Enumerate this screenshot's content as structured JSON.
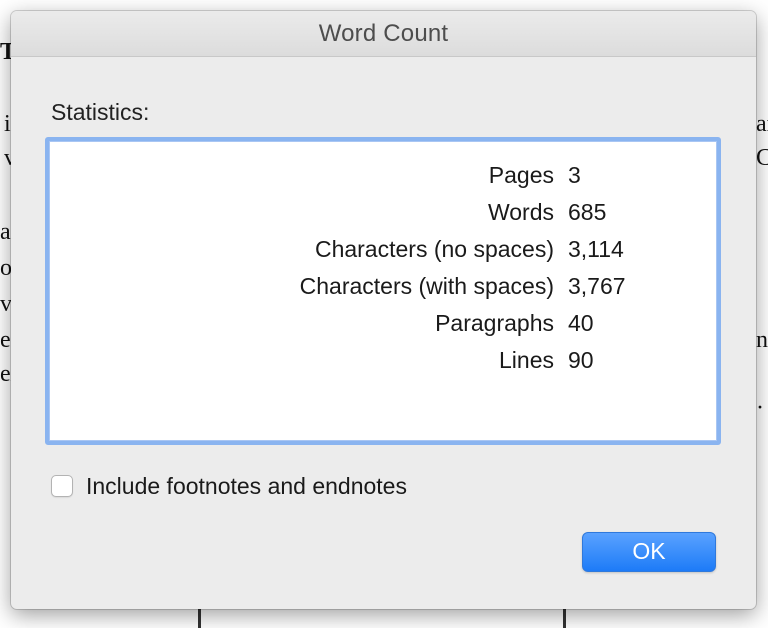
{
  "dialog": {
    "title": "Word Count",
    "statistics_label": "Statistics:",
    "stats": [
      {
        "label": "Pages",
        "value": "3"
      },
      {
        "label": "Words",
        "value": "685"
      },
      {
        "label": "Characters (no spaces)",
        "value": "3,114"
      },
      {
        "label": "Characters (with spaces)",
        "value": "3,767"
      },
      {
        "label": "Paragraphs",
        "value": "40"
      },
      {
        "label": "Lines",
        "value": "90"
      }
    ],
    "include_footnotes_label": "Include footnotes and endnotes",
    "include_footnotes_checked": false,
    "ok_label": "OK",
    "colors": {
      "accent": "#1d7bf7",
      "focus_ring": "#8ab4f0",
      "sheet_bg": "#ececec"
    }
  },
  "background_document": {
    "left_fragments": [
      "T",
      "i",
      "v",
      "ar",
      "o",
      "vi",
      "e",
      "ex"
    ],
    "right_fragments": [
      "ar",
      "C",
      "n",
      "·"
    ]
  }
}
